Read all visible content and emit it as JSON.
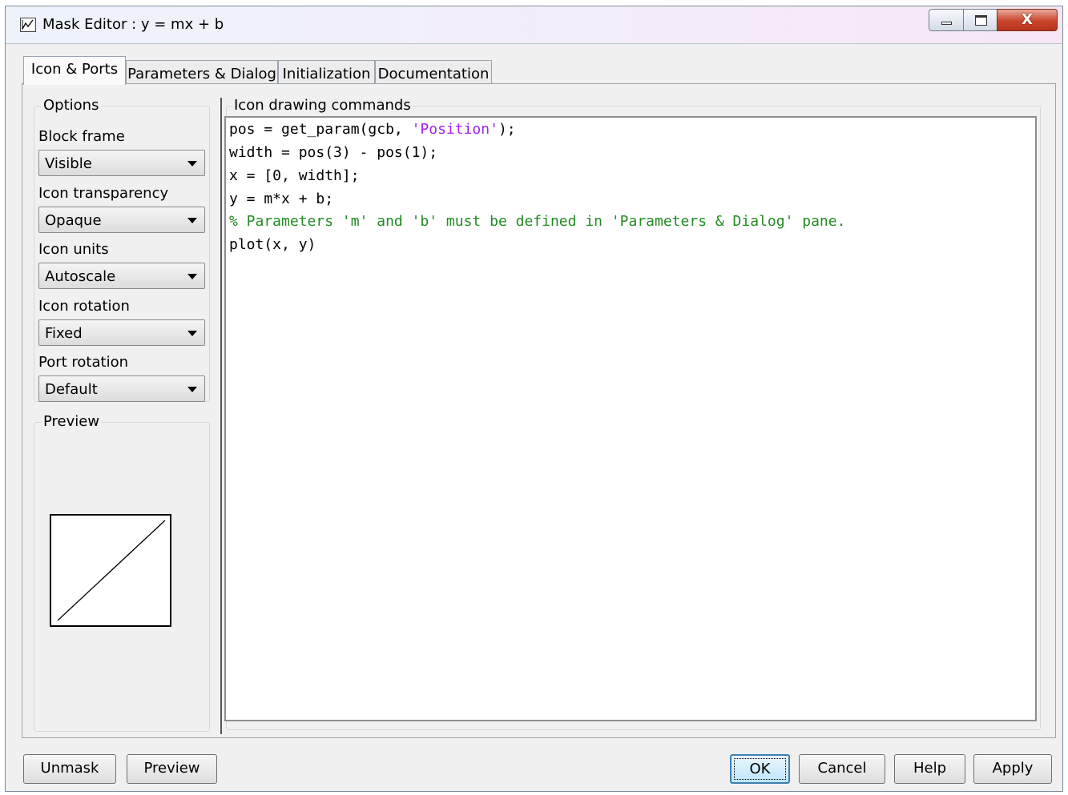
{
  "window": {
    "title": "Mask Editor : y = mx + b",
    "icon": "matlab-window-icon",
    "controls": {
      "minimize": "minimize-icon",
      "maximize": "maximize-icon",
      "close": "close-icon"
    }
  },
  "tabs": [
    {
      "label": "Icon & Ports",
      "active": true
    },
    {
      "label": "Parameters & Dialog",
      "active": false
    },
    {
      "label": "Initialization",
      "active": false
    },
    {
      "label": "Documentation",
      "active": false
    }
  ],
  "options": {
    "group_label": "Options",
    "block_frame": {
      "label": "Block frame",
      "value": "Visible"
    },
    "icon_transparency": {
      "label": "Icon transparency",
      "value": "Opaque"
    },
    "icon_units": {
      "label": "Icon units",
      "value": "Autoscale"
    },
    "icon_rotation": {
      "label": "Icon rotation",
      "value": "Fixed"
    },
    "port_rotation": {
      "label": "Port rotation",
      "value": "Default"
    }
  },
  "preview": {
    "group_label": "Preview"
  },
  "commands": {
    "group_label": "Icon drawing commands",
    "lines": [
      {
        "pre": "pos = get_param(gcb, ",
        "str": "'Position'",
        "post": ");"
      },
      {
        "pre": "width = pos(3) - pos(1);",
        "str": "",
        "post": ""
      },
      {
        "pre": "x = [0, width];",
        "str": "",
        "post": ""
      },
      {
        "pre": "y = m*x + b;",
        "str": "",
        "post": ""
      },
      {
        "comment": "% Parameters 'm' and 'b' must be defined in 'Parameters & Dialog' pane."
      },
      {
        "pre": "plot(x, y)",
        "str": "",
        "post": ""
      }
    ]
  },
  "buttons": {
    "unmask": "Unmask",
    "preview": "Preview",
    "ok": "OK",
    "cancel": "Cancel",
    "help": "Help",
    "apply": "Apply"
  }
}
